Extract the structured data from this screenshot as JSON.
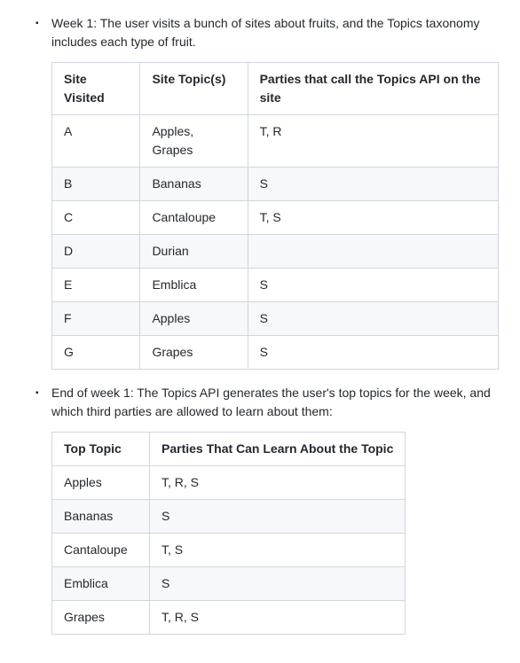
{
  "bullets": [
    {
      "text": "Week 1: The user visits a bunch of sites about fruits, and the Topics taxonomy includes each type of fruit.",
      "table": {
        "headers": [
          "Site Visited",
          "Site Topic(s)",
          "Parties that call the Topics API on the site"
        ],
        "rows": [
          [
            "A",
            "Apples, Grapes",
            "T, R"
          ],
          [
            "B",
            "Bananas",
            "S"
          ],
          [
            "C",
            "Cantaloupe",
            "T, S"
          ],
          [
            "D",
            "Durian",
            ""
          ],
          [
            "E",
            "Emblica",
            "S"
          ],
          [
            "F",
            "Apples",
            "S"
          ],
          [
            "G",
            "Grapes",
            "S"
          ]
        ]
      }
    },
    {
      "text": "End of week 1: The Topics API generates the user's top topics for the week, and which third parties are allowed to learn about them:",
      "table": {
        "headers": [
          "Top Topic",
          "Parties That Can Learn About the Topic"
        ],
        "rows": [
          [
            "Apples",
            "T, R, S"
          ],
          [
            "Bananas",
            "S"
          ],
          [
            "Cantaloupe",
            "T, S"
          ],
          [
            "Emblica",
            "S"
          ],
          [
            "Grapes",
            "T, R, S"
          ]
        ]
      }
    }
  ]
}
